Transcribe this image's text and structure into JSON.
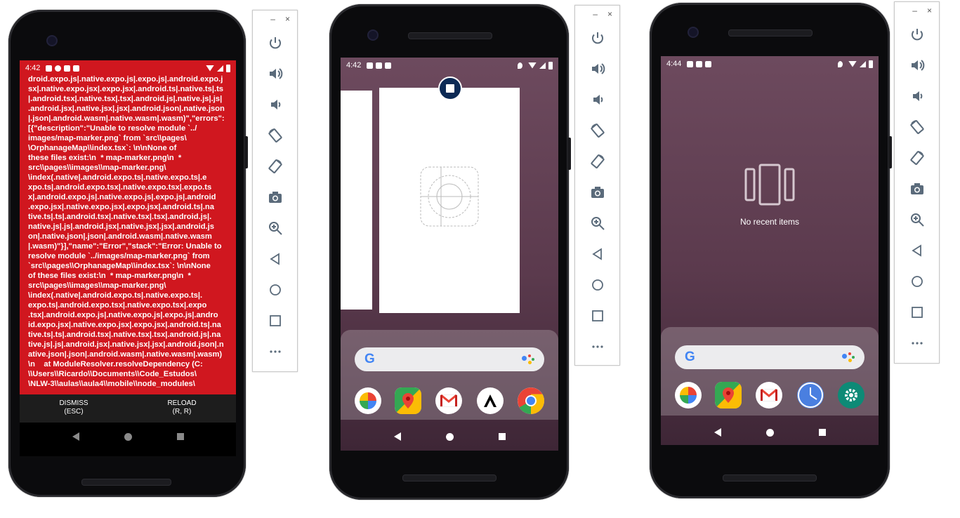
{
  "phones": {
    "left": {
      "status_time": "4:42",
      "error_lines": [
        "droid.expo.js|.native.expo.js|.expo.js|.android.expo.j",
        "sx|.native.expo.jsx|.expo.jsx|.android.ts|.native.ts|.ts",
        "|.android.tsx|.native.tsx|.tsx|.android.js|.native.js|.js|",
        ".android.jsx|.native.jsx|.jsx|.android.json|.native.json",
        "|.json|.android.wasm|.native.wasm|.wasm)\",\"errors\":",
        "[{\"description\":\"Unable to resolve module `../",
        "images/map-marker.png` from `src\\\\pages\\",
        "\\OrphanageMap\\\\index.tsx`: \\n\\nNone of",
        "these files exist:\\n  * map-marker.png\\n  *",
        "src\\\\pages\\\\images\\\\map-marker.png\\",
        "\\index(.native|.android.expo.ts|.native.expo.ts|.e",
        "xpo.ts|.android.expo.tsx|.native.expo.tsx|.expo.ts",
        "x|.android.expo.js|.native.expo.js|.expo.js|.android",
        ".expo.jsx|.native.expo.jsx|.expo.jsx|.android.ts|.na",
        "tive.ts|.ts|.android.tsx|.native.tsx|.tsx|.android.js|.",
        "native.js|.js|.android.jsx|.native.jsx|.jsx|.android.js",
        "on|.native.json|.json|.android.wasm|.native.wasm",
        "|.wasm)\"}],\"name\":\"Error\",\"stack\":\"Error: Unable to",
        "resolve module `../images/map-marker.png` from",
        "`src\\\\pages\\\\OrphanageMap\\\\index.tsx`: \\n\\nNone",
        "of these files exist:\\n  * map-marker.png\\n  *",
        "src\\\\pages\\\\images\\\\map-marker.png\\",
        "\\index(.native|.android.expo.ts|.native.expo.ts|.",
        "expo.ts|.android.expo.tsx|.native.expo.tsx|.expo",
        ".tsx|.android.expo.js|.native.expo.js|.expo.js|.andro",
        "id.expo.jsx|.native.expo.jsx|.expo.jsx|.android.ts|.na",
        "tive.ts|.ts|.android.tsx|.native.tsx|.tsx|.android.js|.na",
        "tive.js|.js|.android.jsx|.native.jsx|.jsx|.android.json|.n",
        "ative.json|.json|.android.wasm|.native.wasm|.wasm)",
        "\\n    at ModuleResolver.resolveDependency (C:",
        "\\\\Users\\\\Ricardo\\\\Documents\\\\Code_Estudos\\",
        "\\NLW-3\\\\aulas\\\\aula4\\\\mobile\\\\node_modules\\"
      ],
      "dismiss_label": "DISMISS\n(ESC)",
      "reload_label": "RELOAD\n(R, R)"
    },
    "middle": {
      "status_time": "4:42"
    },
    "right": {
      "status_time": "4:44",
      "no_recent_label": "No recent items"
    }
  },
  "toolbar": {
    "minimize_label": "–",
    "close_label": "×",
    "buttons": [
      "power-icon",
      "volume-up-icon",
      "volume-down-icon",
      "rotate-left-icon",
      "rotate-right-icon",
      "camera-icon",
      "zoom-icon",
      "back-icon",
      "home-icon",
      "overview-icon",
      "more-icon"
    ]
  },
  "colors": {
    "wallpaper": "#6b4257",
    "error_red": "#d0171f",
    "toolbar_icon": "#5b6b7b"
  }
}
